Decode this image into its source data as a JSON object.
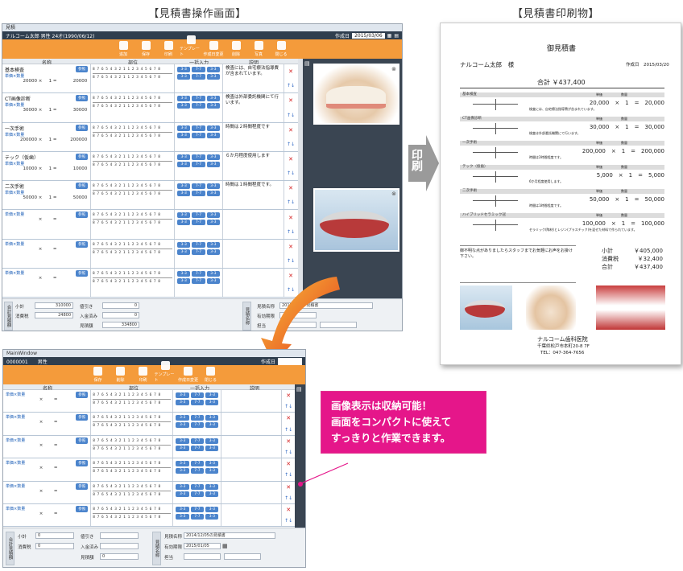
{
  "headings": {
    "screen": "【見積書操作画面】",
    "print": "【見積書印刷物】"
  },
  "big_window": {
    "title": "見積",
    "patient": "ナルコーム太郎 男性 24才(1990/06/12)",
    "date_label": "作成日",
    "date": "2015/03/06",
    "toolbar": [
      {
        "label": "追加",
        "icon": "add-doc-icon"
      },
      {
        "label": "保存",
        "icon": "check-icon"
      },
      {
        "label": "印刷",
        "icon": "printer-icon"
      },
      {
        "label": "テンプレート",
        "icon": "template-icon"
      },
      {
        "label": "作成日変更",
        "icon": "edit-icon"
      },
      {
        "label": "削除",
        "icon": "trash-icon"
      },
      {
        "label": "写真",
        "icon": "photo-icon"
      },
      {
        "label": "閉じる",
        "icon": "close-icon"
      }
    ],
    "columns": {
      "name": "名称",
      "part": "部位",
      "bulk": "一括入力",
      "desc": "説明"
    },
    "ref_label": "参照",
    "sub_label": "単価×数量",
    "tooth_top": "8 7 6 5 4 3 2 1 1 2 3 4 5 6 7 8",
    "tooth_bottom": "8 7 6 5 4 3 2 1 1 2 3 4 5 6 7 8",
    "bulk_top": [
      "3-3",
      "7-7",
      "3-3"
    ],
    "bulk_bottom": [
      "3-3",
      "7-7",
      "3-3"
    ],
    "rows": [
      {
        "name": "基本検査",
        "price": "20000",
        "qty": "1",
        "total": "20000",
        "desc": "検査には、自宅療法指導費が含まれています。"
      },
      {
        "name": "CT画像診断",
        "price": "30000",
        "qty": "1",
        "total": "30000",
        "desc": "検査は外部委託機関にて行います。"
      },
      {
        "name": "一次手術",
        "price": "200000",
        "qty": "1",
        "total": "200000",
        "desc": "時間は２時間程度です"
      },
      {
        "name": "テック（仮歯）",
        "price": "10000",
        "qty": "1",
        "total": "10000",
        "desc": "６か月程度使用します"
      },
      {
        "name": "二次手術",
        "price": "50000",
        "qty": "1",
        "total": "50000",
        "desc": "時間は１時間程度です。"
      },
      {
        "name": "",
        "price": "",
        "qty": "",
        "total": "",
        "desc": ""
      },
      {
        "name": "",
        "price": "",
        "qty": "",
        "total": "",
        "desc": ""
      },
      {
        "name": "",
        "price": "",
        "qty": "",
        "total": "",
        "desc": ""
      }
    ],
    "totals": {
      "section_label": "合計見積額",
      "subtotal_label": "小計",
      "subtotal": "310000",
      "tax_label": "消費税",
      "tax": "24800",
      "discount_label": "値引き",
      "discount": "0",
      "deposit_label": "入金済み",
      "deposit": "0",
      "estimate_label": "見積額",
      "estimate": "334800"
    },
    "memo": {
      "section_label": "見積名称",
      "name_label": "見積名称",
      "name": "2015/03/06 見積書",
      "expire_label": "有効期限",
      "staff_label": "担当"
    }
  },
  "print_banner": "印刷",
  "paper": {
    "title": "御見積書",
    "patient": "ナルコーム太郎　様",
    "date": "作成日　2015/03/20",
    "total": "合計 ￥437,400",
    "col_price": "単価",
    "col_qty": "数量",
    "items": [
      {
        "name": "基本検査",
        "line": "20,000　×　1　=　20,000",
        "note": "検査には、自宅療法指導費が含まれています。"
      },
      {
        "name": "CT画像診断",
        "line": "30,000　×　1　=　30,000",
        "note": "検査は外部委託機関にて行います。"
      },
      {
        "name": "一次手術",
        "line": "200,000　×　1　=　200,000",
        "note": "時間は2時間程度です。"
      },
      {
        "name": "テック（仮歯）",
        "line": "5,000　×　1　=　5,000",
        "note": "6か月程度使用します。"
      },
      {
        "name": "二次手術",
        "line": "50,000　×　1　=　50,000",
        "note": "時間は1時間程度です。"
      },
      {
        "name": "ハイブリッドセラミック冠",
        "line": "100,000　×　1　=　100,000",
        "note": "セラミック(陶材)とレジン(プラスチック)を混ぜた材料で作られています。"
      }
    ],
    "note": "御不明な点がありましたらスタッフまでお気軽にお声をお掛け下さい。",
    "sum_rows": [
      {
        "label": "小計",
        "value": "￥405,000"
      },
      {
        "label": "消費税",
        "value": "￥32,400"
      },
      {
        "label": "合計",
        "value": "￥437,400"
      }
    ],
    "clinic": "ナルコーム歯科医院",
    "address": "千葉県松戸市本町20-8 7F",
    "tel": "TEL：047-364-7656"
  },
  "small_window": {
    "title": "MainWindow",
    "patient": "0000001　　男性",
    "date_label": "作成日",
    "toolbar": [
      {
        "label": "保存",
        "icon": "check-icon"
      },
      {
        "label": "削除",
        "icon": "trash-icon"
      },
      {
        "label": "印刷",
        "icon": "printer-icon"
      },
      {
        "label": "テンプレート",
        "icon": "template-icon"
      },
      {
        "label": "作成日変更",
        "icon": "edit-icon"
      },
      {
        "label": "閉じる",
        "icon": "close-icon"
      }
    ],
    "columns": {
      "name": "名称",
      "part": "部位",
      "bulk": "一括入力",
      "desc": "説明"
    },
    "totals": {
      "section_label": "合計見積額",
      "subtotal_label": "小計",
      "subtotal": "0",
      "tax_label": "消費税",
      "tax": "0",
      "discount_label": "値引き",
      "discount": "",
      "deposit_label": "入金済み",
      "deposit": "",
      "estimate_label": "見積額",
      "estimate": "0"
    },
    "memo": {
      "section_label": "見積名称",
      "name_label": "見積名称",
      "name": "2014/12/05の見積書",
      "expire_label": "有効期限",
      "expire": "2015/01/05",
      "staff_label": "担当"
    }
  },
  "callout": {
    "line1": "画像表示は収納可能！",
    "line2": "画面をコンパクトに使えて",
    "line3": "すっきりと作業できます。"
  },
  "colors": {
    "orange": "#f49b3b",
    "dark": "#2f3e4e",
    "blue": "#4b84cc",
    "pink": "#e5168a"
  }
}
